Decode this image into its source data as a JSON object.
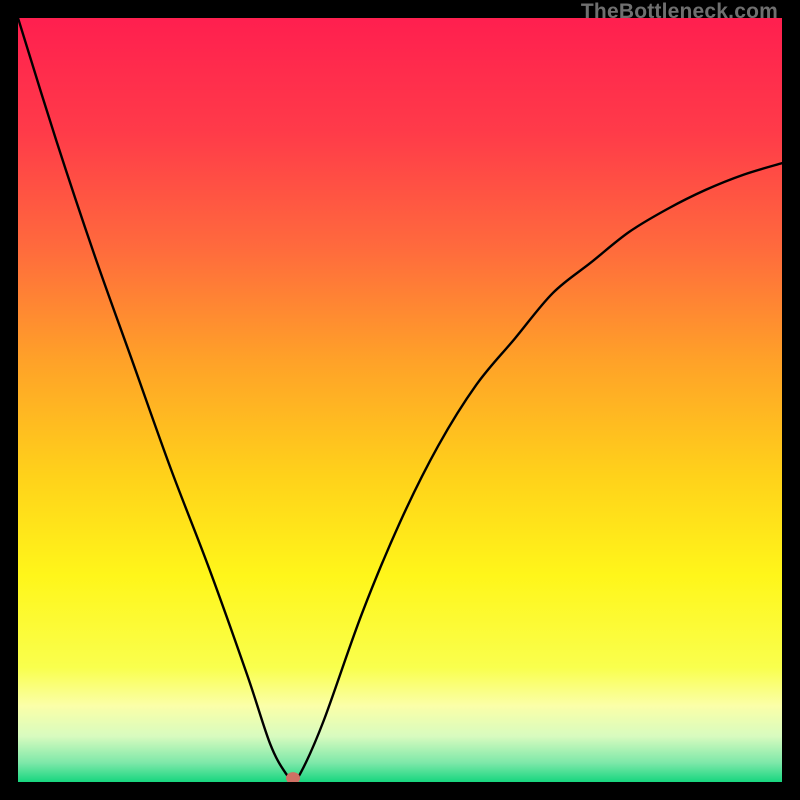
{
  "watermark": "TheBottleneck.com",
  "chart_data": {
    "type": "line",
    "title": "",
    "xlabel": "",
    "ylabel": "",
    "xlim": [
      0,
      100
    ],
    "ylim": [
      0,
      100
    ],
    "grid": false,
    "legend": false,
    "annotations": [],
    "series": [
      {
        "name": "curve",
        "color": "#000000",
        "x": [
          0,
          5,
          10,
          15,
          20,
          25,
          30,
          33,
          35,
          36,
          37,
          40,
          45,
          50,
          55,
          60,
          65,
          70,
          75,
          80,
          85,
          90,
          95,
          100
        ],
        "y": [
          100,
          84,
          69,
          55,
          41,
          28,
          14,
          5,
          1.2,
          0.5,
          1.2,
          8,
          22,
          34,
          44,
          52,
          58,
          64,
          68,
          72,
          75,
          77.5,
          79.5,
          81
        ]
      }
    ],
    "minimum_marker": {
      "x": 36,
      "y": 0.5,
      "color": "#cf7064"
    },
    "background_gradient": {
      "stops": [
        {
          "offset": 0.0,
          "color": "#ff1f4f"
        },
        {
          "offset": 0.15,
          "color": "#ff3b49"
        },
        {
          "offset": 0.3,
          "color": "#ff6a3d"
        },
        {
          "offset": 0.45,
          "color": "#ffa228"
        },
        {
          "offset": 0.6,
          "color": "#ffd21a"
        },
        {
          "offset": 0.73,
          "color": "#fff61a"
        },
        {
          "offset": 0.85,
          "color": "#f9ff4d"
        },
        {
          "offset": 0.9,
          "color": "#fbffa8"
        },
        {
          "offset": 0.94,
          "color": "#d8fbbf"
        },
        {
          "offset": 0.975,
          "color": "#7de8a9"
        },
        {
          "offset": 1.0,
          "color": "#17d67f"
        }
      ]
    }
  }
}
